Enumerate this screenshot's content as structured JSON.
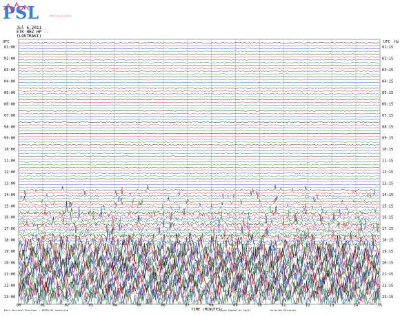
{
  "logo": {
    "text": "PSL",
    "subtext": "Public Seismic Network",
    "colors": {
      "primary": "#2f7fd6",
      "accent": "#e8237b"
    }
  },
  "header": {
    "date": "Jul 6,2011",
    "station": "ETK HHZ HP --",
    "location": "(LOUTRAKI)"
  },
  "axis": {
    "left_title": "UTC",
    "right_title": "UTC",
    "right_extra": "Hz",
    "x_title": "TIME (MINUTES)",
    "left_hours": [
      "01:00",
      "02:00",
      "03:00",
      "04:00",
      "05:00",
      "06:00",
      "07:00",
      "08:00",
      "09:00",
      "10:00",
      "11:00",
      "12:00",
      "13:00",
      "14:00",
      "15:00",
      "16:00",
      "17:00",
      "18:00",
      "19:00",
      "20:00",
      "21:00",
      "22:00",
      "23:00"
    ],
    "right_hours": [
      "01:15",
      "02:15",
      "03:15",
      "04:15",
      "05:15",
      "06:15",
      "07:15",
      "08:15",
      "09:15",
      "10:15",
      "11:15",
      "12:15",
      "13:15",
      "14:15",
      "15:15",
      "16:15",
      "17:15",
      "18:15",
      "19:15",
      "20:15",
      "21:15",
      "22:15",
      "23:15"
    ],
    "minute_ticks": [
      "00",
      "01",
      "02",
      "03",
      "04",
      "05",
      "06",
      "07",
      "08",
      "09",
      "10",
      "11",
      "12",
      "13",
      "14",
      "15"
    ]
  },
  "footer": {
    "left_note": "East Vertical Division = 19925.01 counts/cm",
    "middle_note": "Trace Signal of Sb/Sf",
    "right_note": "Vertical Division"
  },
  "trace_colors": [
    "#000000",
    "#e01818",
    "#1530e0",
    "#0a8a1a"
  ],
  "quiet_traces_end_hour": 14,
  "noisy_from_hour": 19
}
